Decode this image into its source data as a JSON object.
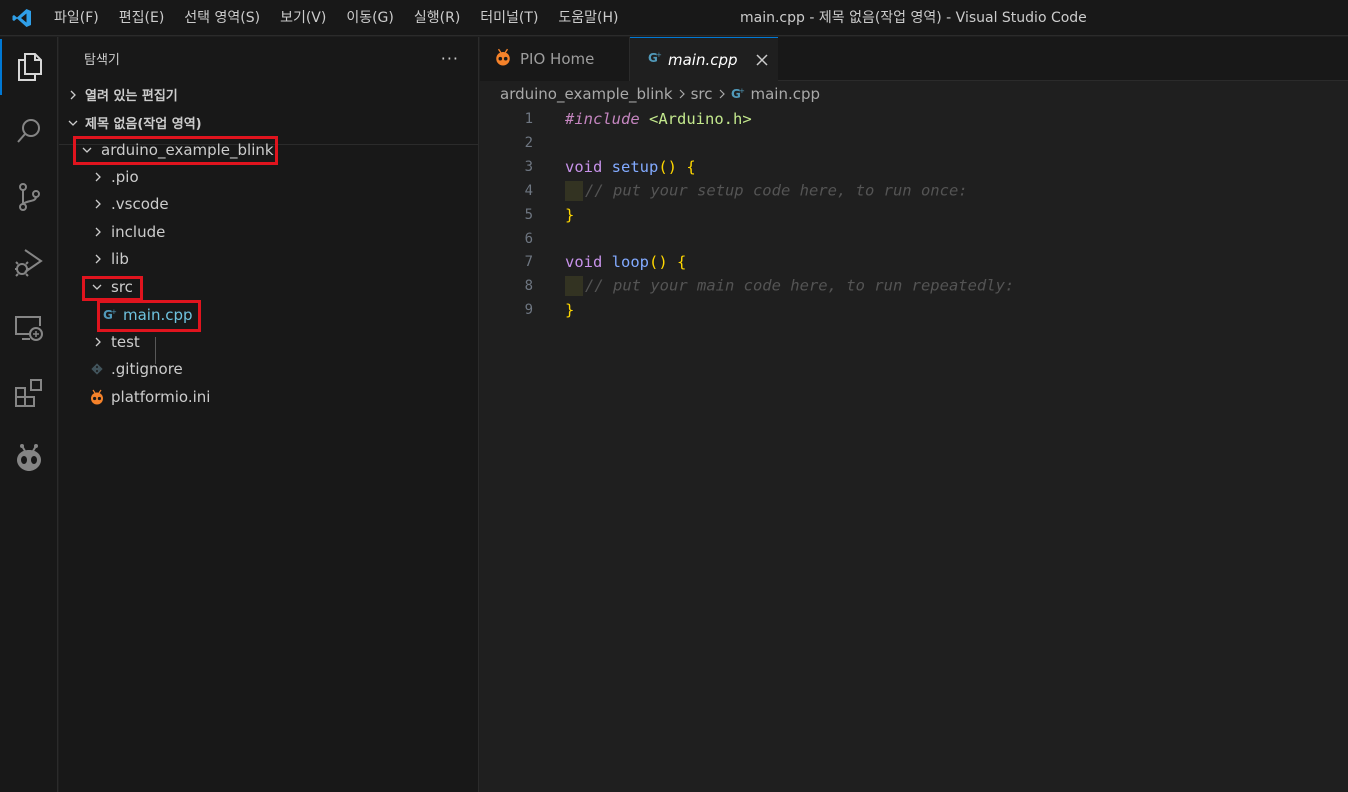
{
  "titlebar": {
    "menu": [
      "파일(F)",
      "편집(E)",
      "선택 영역(S)",
      "보기(V)",
      "이동(G)",
      "실행(R)",
      "터미널(T)",
      "도움말(H)"
    ],
    "window_title": "main.cpp - 제목 없음(작업 영역) - Visual Studio Code"
  },
  "activitybar": {
    "items": [
      "explorer-icon",
      "search-icon",
      "source-control-icon",
      "run-debug-icon",
      "remote-explorer-icon",
      "extensions-icon",
      "platformio-icon"
    ]
  },
  "sidebar": {
    "title": "탐색기",
    "more": "···",
    "sections": {
      "open_editors": "열려 있는 편집기",
      "workspace": "제목 없음(작업 영역)"
    },
    "tree": [
      {
        "label": "arduino_example_blink",
        "type": "folder",
        "expanded": true
      },
      {
        "label": ".pio",
        "type": "folder",
        "expanded": false
      },
      {
        "label": ".vscode",
        "type": "folder",
        "expanded": false
      },
      {
        "label": "include",
        "type": "folder",
        "expanded": false
      },
      {
        "label": "lib",
        "type": "folder",
        "expanded": false
      },
      {
        "label": "src",
        "type": "folder",
        "expanded": true
      },
      {
        "label": "main.cpp",
        "type": "file",
        "selected": true
      },
      {
        "label": "test",
        "type": "folder",
        "expanded": false
      },
      {
        "label": ".gitignore",
        "type": "file"
      },
      {
        "label": "platformio.ini",
        "type": "file"
      }
    ]
  },
  "editor": {
    "tabs": [
      {
        "label": "PIO Home",
        "active": false
      },
      {
        "label": "main.cpp",
        "active": true
      }
    ],
    "breadcrumb": [
      "arduino_example_blink",
      "src",
      "main.cpp"
    ],
    "code": {
      "line_numbers": [
        "1",
        "2",
        "3",
        "4",
        "5",
        "6",
        "7",
        "8",
        "9"
      ],
      "l1_kw": "#include",
      "l1_inc": "<Arduino.h>",
      "l3_type": "void",
      "l3_fn": "setup",
      "l3_br": "() {",
      "l4_cm": "// put your setup code here, to run once:",
      "l5_br": "}",
      "l7_type": "void",
      "l7_fn": "loop",
      "l7_br": "() {",
      "l8_cm": "// put your main code here, to run repeatedly:",
      "l9_br": "}"
    }
  },
  "colors": {
    "highlight_box": "#e0141e",
    "accent": "#0078d4",
    "platformio_orange": "#f5822a"
  }
}
